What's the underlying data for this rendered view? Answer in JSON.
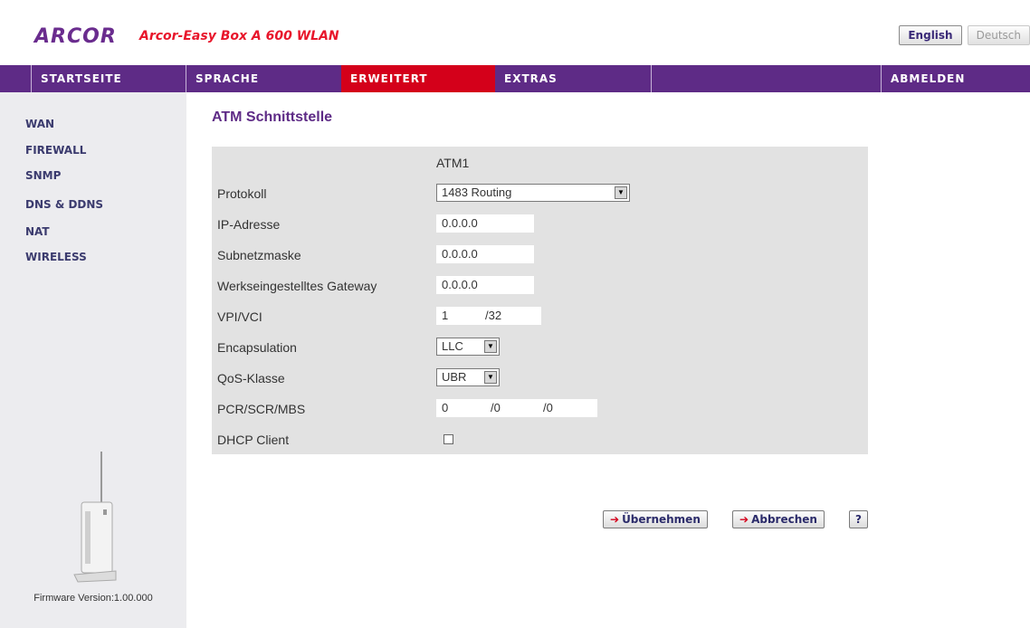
{
  "header": {
    "logo": "ARCOR",
    "product": "Arcor-Easy Box A 600 WLAN",
    "languages": [
      "English",
      "Deutsch"
    ]
  },
  "nav": [
    "STARTSEITE",
    "SPRACHE",
    "ERWEITERT",
    "EXTRAS",
    "ABMELDEN"
  ],
  "sidebar": {
    "items": [
      "WAN",
      "FIREWALL",
      "SNMP",
      "DNS & DDNS",
      "NAT",
      "WIRELESS"
    ],
    "firmware": "Firmware Version:1.00.000"
  },
  "main": {
    "title": "ATM Schnittstelle",
    "column_header": "ATM1",
    "fields": {
      "protokoll": {
        "label": "Protokoll",
        "value": "1483 Routing"
      },
      "ip": {
        "label": "IP-Adresse",
        "value": "0.0.0.0"
      },
      "subnet": {
        "label": "Subnetzmaske",
        "value": "0.0.0.0"
      },
      "gateway": {
        "label": "Werkseingestelltes Gateway",
        "value": "0.0.0.0"
      },
      "vpivci": {
        "label": "VPI/VCI",
        "vpi": "1",
        "vci": "/32"
      },
      "encapsulation": {
        "label": "Encapsulation",
        "value": "LLC"
      },
      "qos": {
        "label": "QoS-Klasse",
        "value": "UBR"
      },
      "pcr": {
        "label": "PCR/SCR/MBS",
        "pcr": "0",
        "scr": "/0",
        "mbs": "/0"
      },
      "dhcp": {
        "label": "DHCP Client",
        "checked": false
      }
    },
    "buttons": {
      "apply": "Übernehmen",
      "cancel": "Abbrechen",
      "help": "?"
    }
  }
}
